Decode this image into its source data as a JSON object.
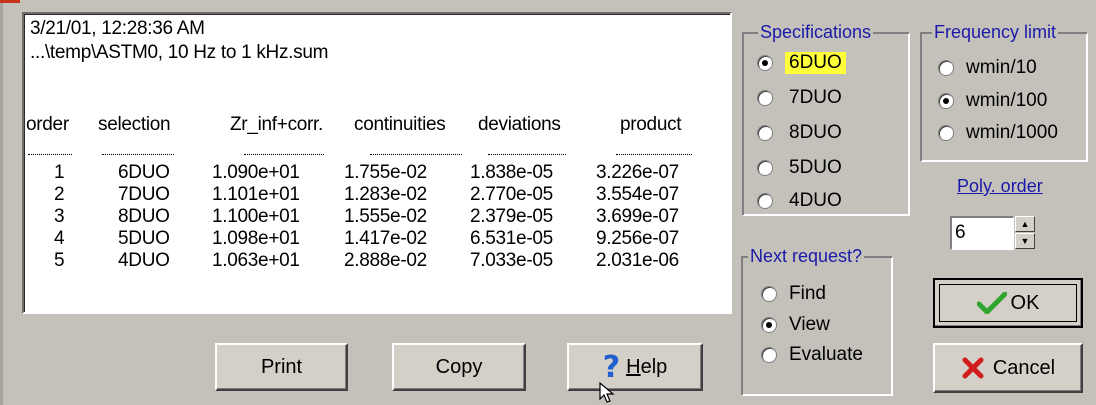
{
  "report": {
    "timestamp": "3/21/01, 12:28:36 AM",
    "file": "...\\temp\\ASTM0, 10 Hz to 1 kHz.sum",
    "columns": [
      "order",
      "selection",
      "Zr_inf+corr.",
      "continuities",
      "deviations",
      "product"
    ],
    "rows": [
      [
        "1",
        "6DUO",
        "1.090e+01",
        "1.755e-02",
        "1.838e-05",
        "3.226e-07"
      ],
      [
        "2",
        "7DUO",
        "1.101e+01",
        "1.283e-02",
        "2.770e-05",
        "3.554e-07"
      ],
      [
        "3",
        "8DUO",
        "1.100e+01",
        "1.555e-02",
        "2.379e-05",
        "3.699e-07"
      ],
      [
        "4",
        "5DUO",
        "1.098e+01",
        "1.417e-02",
        "6.531e-05",
        "9.256e-07"
      ],
      [
        "5",
        "4DUO",
        "1.063e+01",
        "2.888e-02",
        "7.033e-05",
        "2.031e-06"
      ]
    ]
  },
  "buttons": {
    "print": "Print",
    "copy": "Copy",
    "help_prefix": "H",
    "help_rest": "elp",
    "ok": "OK",
    "cancel": "Cancel"
  },
  "specifications": {
    "title": "Specifications",
    "options": [
      "6DUO",
      "7DUO",
      "8DUO",
      "5DUO",
      "4DUO"
    ],
    "selected": "6DUO"
  },
  "frequency_limit": {
    "title": "Frequency limit",
    "options": [
      "wmin/10",
      "wmin/100",
      "wmin/1000"
    ],
    "selected": "wmin/100"
  },
  "poly_order": {
    "label": "Poly. order",
    "value": "6"
  },
  "next_request": {
    "title": "Next request?",
    "options": [
      "Find",
      "View",
      "Evaluate"
    ],
    "selected": "View"
  },
  "colors": {
    "legend_blue": "#1a1aa8",
    "highlight_yellow": "#ffff3a",
    "ok_green": "#2fa52f",
    "cancel_red": "#d21b1b",
    "help_blue": "#1f5fd0"
  },
  "icons": {
    "help": "question-mark-icon",
    "ok": "checkmark-icon",
    "cancel": "x-mark-icon",
    "cursor": "mouse-pointer-icon"
  }
}
